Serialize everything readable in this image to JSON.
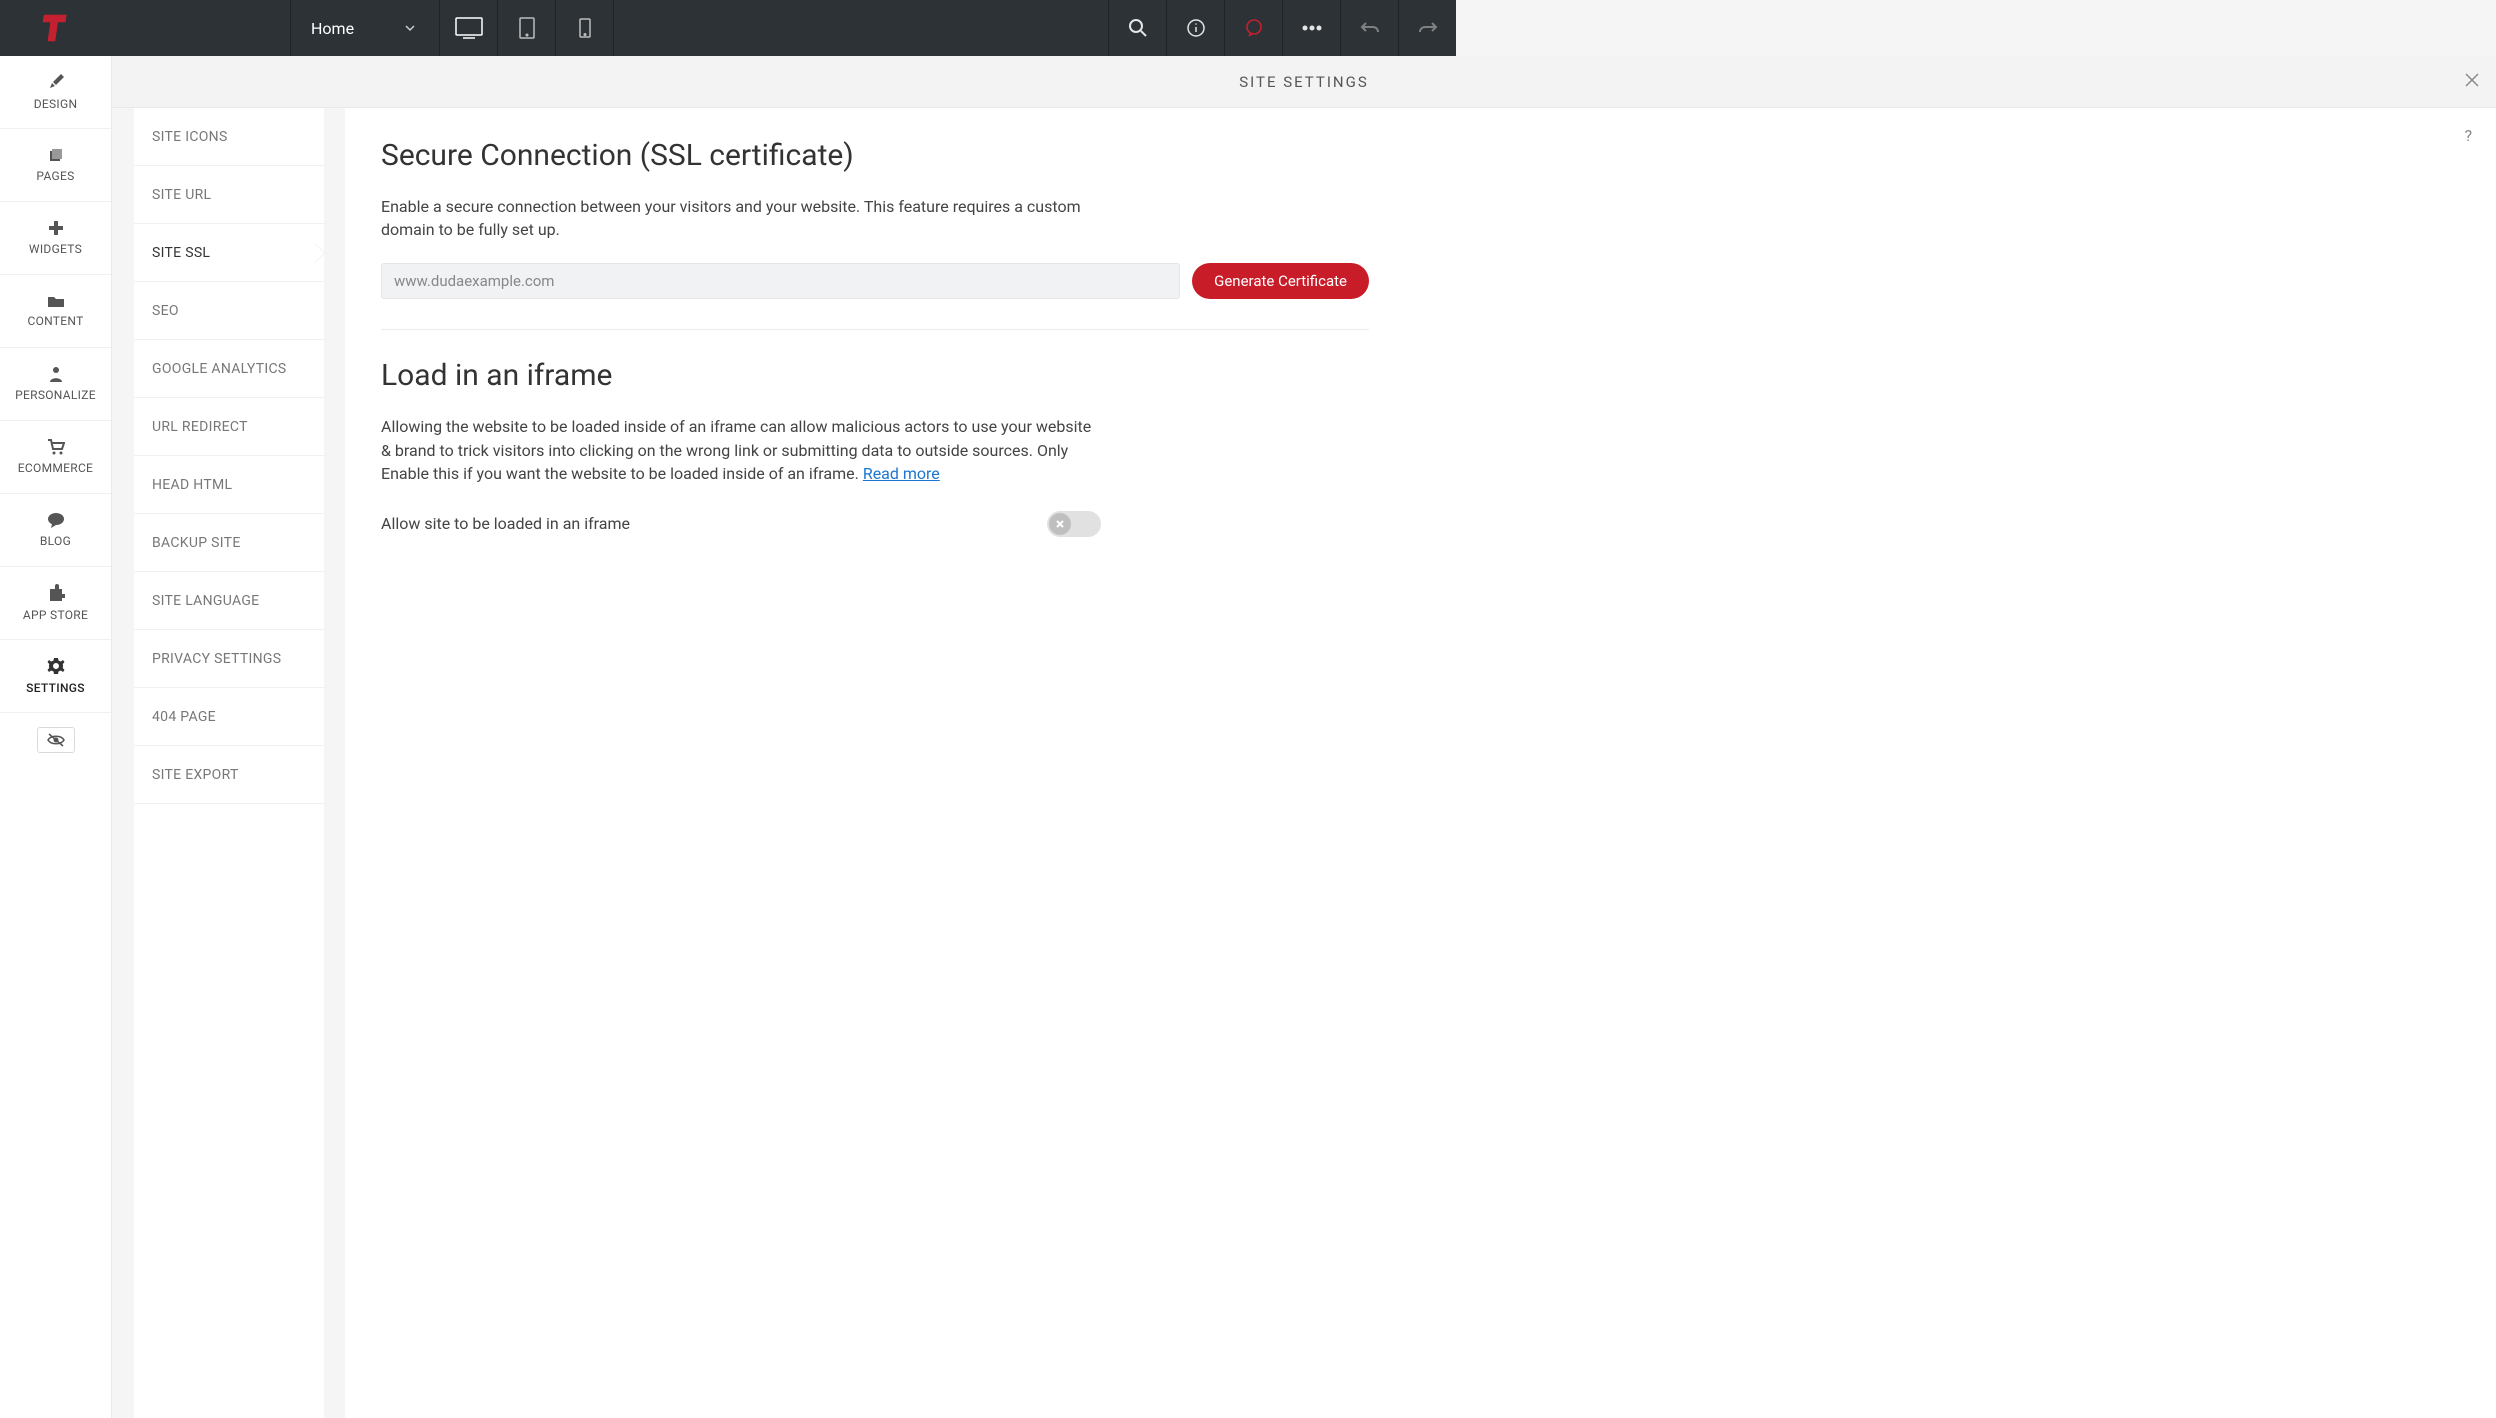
{
  "topbar": {
    "page_select": "Home"
  },
  "leftrail": {
    "items": [
      {
        "label": "DESIGN"
      },
      {
        "label": "PAGES"
      },
      {
        "label": "WIDGETS"
      },
      {
        "label": "CONTENT"
      },
      {
        "label": "PERSONALIZE"
      },
      {
        "label": "ECOMMERCE"
      },
      {
        "label": "BLOG"
      },
      {
        "label": "APP STORE"
      },
      {
        "label": "SETTINGS"
      }
    ]
  },
  "panel": {
    "title": "SITE SETTINGS"
  },
  "submenu": {
    "items": [
      {
        "label": "SITE ICONS"
      },
      {
        "label": "SITE URL"
      },
      {
        "label": "SITE SSL"
      },
      {
        "label": "SEO"
      },
      {
        "label": "GOOGLE ANALYTICS"
      },
      {
        "label": "URL REDIRECT"
      },
      {
        "label": "HEAD HTML"
      },
      {
        "label": "BACKUP SITE"
      },
      {
        "label": "SITE LANGUAGE"
      },
      {
        "label": "PRIVACY SETTINGS"
      },
      {
        "label": "404 PAGE"
      },
      {
        "label": "SITE EXPORT"
      }
    ]
  },
  "content": {
    "help": "?",
    "ssl": {
      "title": "Secure Connection (SSL certificate)",
      "desc": "Enable a secure connection between your visitors and your website. This feature requires a custom domain to be fully set up.",
      "domain": "www.dudaexample.com",
      "button": "Generate Certificate"
    },
    "iframe": {
      "title": "Load in an iframe",
      "desc": "Allowing the website to be loaded inside of an iframe can allow malicious actors to use your website & brand to trick visitors into clicking on the wrong link or submitting data to outside sources. Only Enable this if you want the website to be loaded inside of an iframe. ",
      "readmore": "Read more",
      "toggle_label": "Allow site to be loaded in an iframe"
    }
  }
}
